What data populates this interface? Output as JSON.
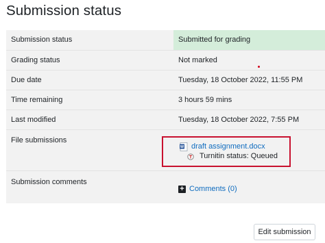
{
  "page": {
    "heading": "Submission status"
  },
  "rows": [
    {
      "label": "Submission status",
      "value": "Submitted for grading"
    },
    {
      "label": "Grading status",
      "value": "Not marked"
    },
    {
      "label": "Due date",
      "value": "Tuesday, 18 October 2022, 11:55 PM"
    },
    {
      "label": "Time remaining",
      "value": "3 hours 59 mins"
    },
    {
      "label": "Last modified",
      "value": "Tuesday, 18 October 2022, 7:55 PM"
    },
    {
      "label": "File submissions",
      "value": ""
    },
    {
      "label": "Submission comments",
      "value": ""
    }
  ],
  "files": {
    "filename": "draft assignment.docx",
    "turnitin_status": "Turnitin status: Queued"
  },
  "comments": {
    "link_label": "Comments (0)"
  },
  "actions": {
    "edit_label": "Edit submission"
  },
  "colors": {
    "submitted_bg": "#d4edda",
    "link": "#0f6cbf",
    "highlight_border": "#c8102e"
  },
  "icons": {
    "word_file": "word-doc-icon",
    "turnitin": "turnitin-icon",
    "expand": "plus-icon"
  }
}
